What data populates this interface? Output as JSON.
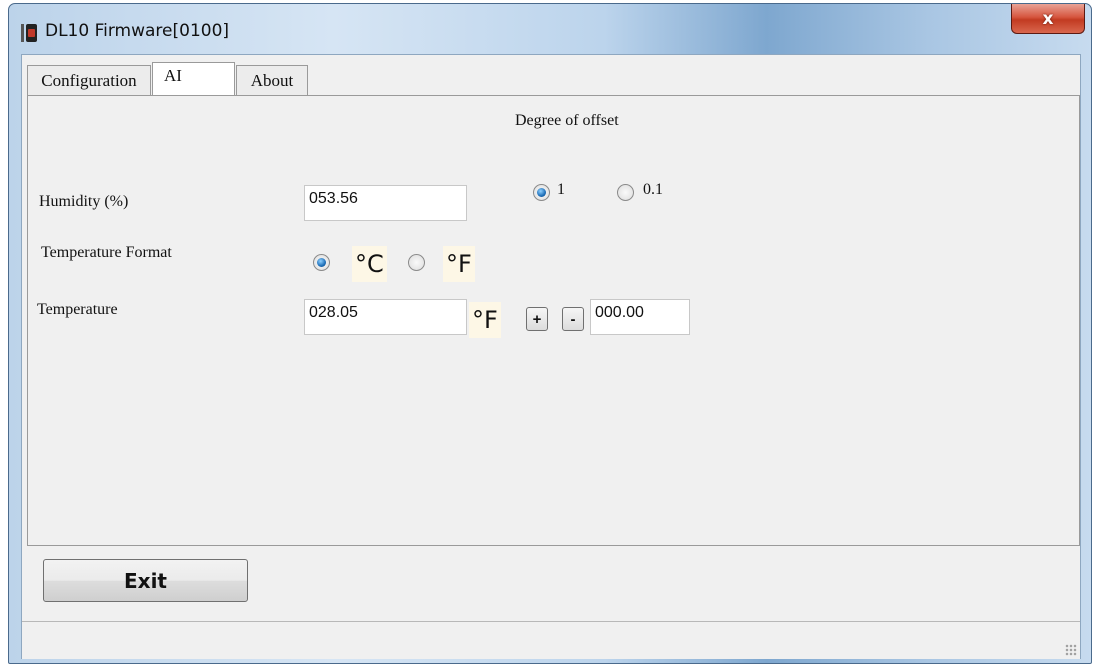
{
  "window": {
    "title": "DL10 Firmware[0100]",
    "close_label": "x"
  },
  "tabs": [
    {
      "label": "Configuration"
    },
    {
      "label": "AI"
    },
    {
      "label": "About"
    }
  ],
  "ai_panel": {
    "offset_heading": "Degree of offset",
    "humidity_label": "Humidity (%)",
    "humidity_value": "053.56",
    "offset_options": [
      {
        "label": "1",
        "selected": true
      },
      {
        "label": "0.1",
        "selected": false
      }
    ],
    "temp_format_label": "Temperature Format",
    "format_options": [
      {
        "label": "°C",
        "selected": true
      },
      {
        "label": "°F",
        "selected": false
      }
    ],
    "temperature_label": "Temperature",
    "temperature_value": "028.05",
    "temperature_unit": "°F",
    "plus_label": "+",
    "minus_label": "-",
    "offset_value": "000.00"
  },
  "exit_label": "Exit",
  "icons": {
    "app": "device-icon",
    "close": "close-icon",
    "grip": "resize-grip-icon"
  },
  "colors": {
    "close_red": "#c23b22",
    "radio_blue": "#1e6fb8",
    "unit_bg": "#fdf7e6"
  }
}
